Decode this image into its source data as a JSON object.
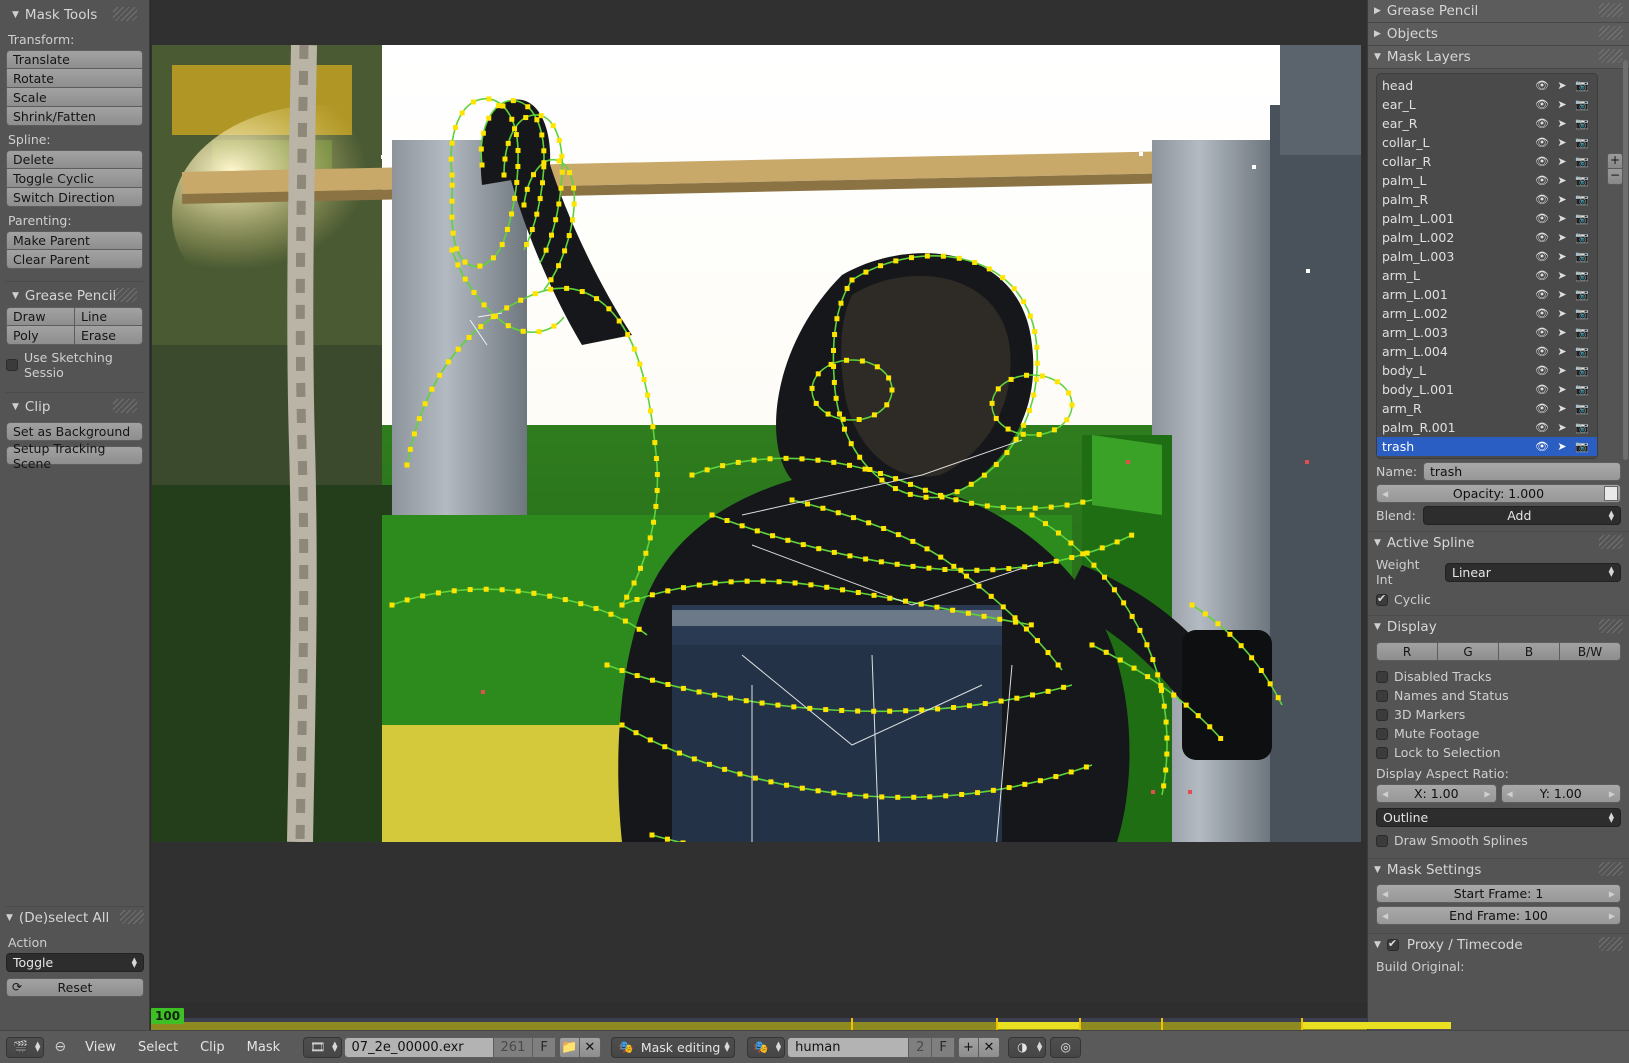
{
  "left_panel": {
    "mask_tools": {
      "title": "Mask Tools",
      "transform_label": "Transform:",
      "transform_buttons": [
        "Translate",
        "Rotate",
        "Scale",
        "Shrink/Fatten"
      ],
      "spline_label": "Spline:",
      "spline_buttons": [
        "Delete",
        "Toggle Cyclic",
        "Switch Direction"
      ],
      "parenting_label": "Parenting:",
      "parenting_buttons": [
        "Make Parent",
        "Clear Parent"
      ]
    },
    "grease_pencil": {
      "title": "Grease Pencil",
      "buttons": [
        "Draw",
        "Line",
        "Poly",
        "Erase"
      ],
      "checkbox_label": "Use Sketching Sessio",
      "checkbox_checked": false
    },
    "clip": {
      "title": "Clip",
      "buttons": [
        "Set as Background",
        "Setup Tracking Scene"
      ]
    },
    "deselect_all": {
      "title": "(De)select All",
      "action_label": "Action",
      "action_value": "Toggle",
      "reset_label": "Reset"
    }
  },
  "right_panel": {
    "grease_pencil_title": "Grease Pencil",
    "objects_title": "Objects",
    "mask_layers_title": "Mask Layers",
    "layers": [
      {
        "name": "head",
        "selected": false
      },
      {
        "name": "ear_L",
        "selected": false
      },
      {
        "name": "ear_R",
        "selected": false
      },
      {
        "name": "collar_L",
        "selected": false
      },
      {
        "name": "collar_R",
        "selected": false
      },
      {
        "name": "palm_L",
        "selected": false
      },
      {
        "name": "palm_R",
        "selected": false
      },
      {
        "name": "palm_L.001",
        "selected": false
      },
      {
        "name": "palm_L.002",
        "selected": false
      },
      {
        "name": "palm_L.003",
        "selected": false
      },
      {
        "name": "arm_L",
        "selected": false
      },
      {
        "name": "arm_L.001",
        "selected": false
      },
      {
        "name": "arm_L.002",
        "selected": false
      },
      {
        "name": "arm_L.003",
        "selected": false
      },
      {
        "name": "arm_L.004",
        "selected": false
      },
      {
        "name": "body_L",
        "selected": false
      },
      {
        "name": "body_L.001",
        "selected": false
      },
      {
        "name": "arm_R",
        "selected": false
      },
      {
        "name": "palm_R.001",
        "selected": false
      },
      {
        "name": "trash",
        "selected": true
      }
    ],
    "layer_add_label": "+",
    "layer_remove_label": "−",
    "name_label": "Name:",
    "name_value": "trash",
    "opacity_label": "Opacity: 1.000",
    "blend_label": "Blend:",
    "blend_value": "Add",
    "active_spline_title": "Active Spline",
    "weight_int_label": "Weight Int",
    "weight_int_value": "Linear",
    "cyclic_label": "Cyclic",
    "cyclic_checked": true,
    "display_title": "Display",
    "channel_buttons": [
      "R",
      "G",
      "B",
      "B/W"
    ],
    "display_checkboxes": [
      {
        "label": "Disabled Tracks",
        "checked": false
      },
      {
        "label": "Names and Status",
        "checked": false
      },
      {
        "label": "3D Markers",
        "checked": false
      },
      {
        "label": "Mute Footage",
        "checked": false
      },
      {
        "label": "Lock to Selection",
        "checked": false
      }
    ],
    "aspect_label": "Display Aspect Ratio:",
    "aspect_x": "X: 1.00",
    "aspect_y": "Y: 1.00",
    "outline_value": "Outline",
    "draw_smooth_label": "Draw Smooth Splines",
    "draw_smooth_checked": false,
    "mask_settings_title": "Mask Settings",
    "start_frame": "Start Frame: 1",
    "end_frame": "End Frame: 100",
    "proxy_title": "Proxy / Timecode",
    "proxy_checked": true,
    "build_original": "Build Original:"
  },
  "timeline": {
    "current_frame_label": "100"
  },
  "statusbar": {
    "editor_icon": "clip-editor-icon",
    "collapse_icon": "⊖",
    "menus": [
      "View",
      "Select",
      "Clip",
      "Mask"
    ],
    "clip_datablock_icon": "clip-icon",
    "clip_name": "07_2e_00000.exr",
    "clip_users": "261",
    "fake_user_label": "F",
    "open_icon": "folder-icon",
    "unlink_icon": "✕",
    "mode_icon": "mask-icon",
    "mode_value": "Mask editing",
    "mask_datablock_icon": "mask-icon",
    "mask_name": "human",
    "mask_users": "2",
    "mask_fake_user": "F",
    "new_mask_label": "+",
    "unlink_mask_label": "✕",
    "pivot_icon": "pivot-icon",
    "proportional_icon": "proportional-edit-icon"
  },
  "colors": {
    "accent_blue": "#2b5ec2",
    "frame_green": "#3fbf26",
    "keyframe_yellow": "#e8e020",
    "panel_bg": "#545454",
    "viewport_bg": "#303030"
  }
}
